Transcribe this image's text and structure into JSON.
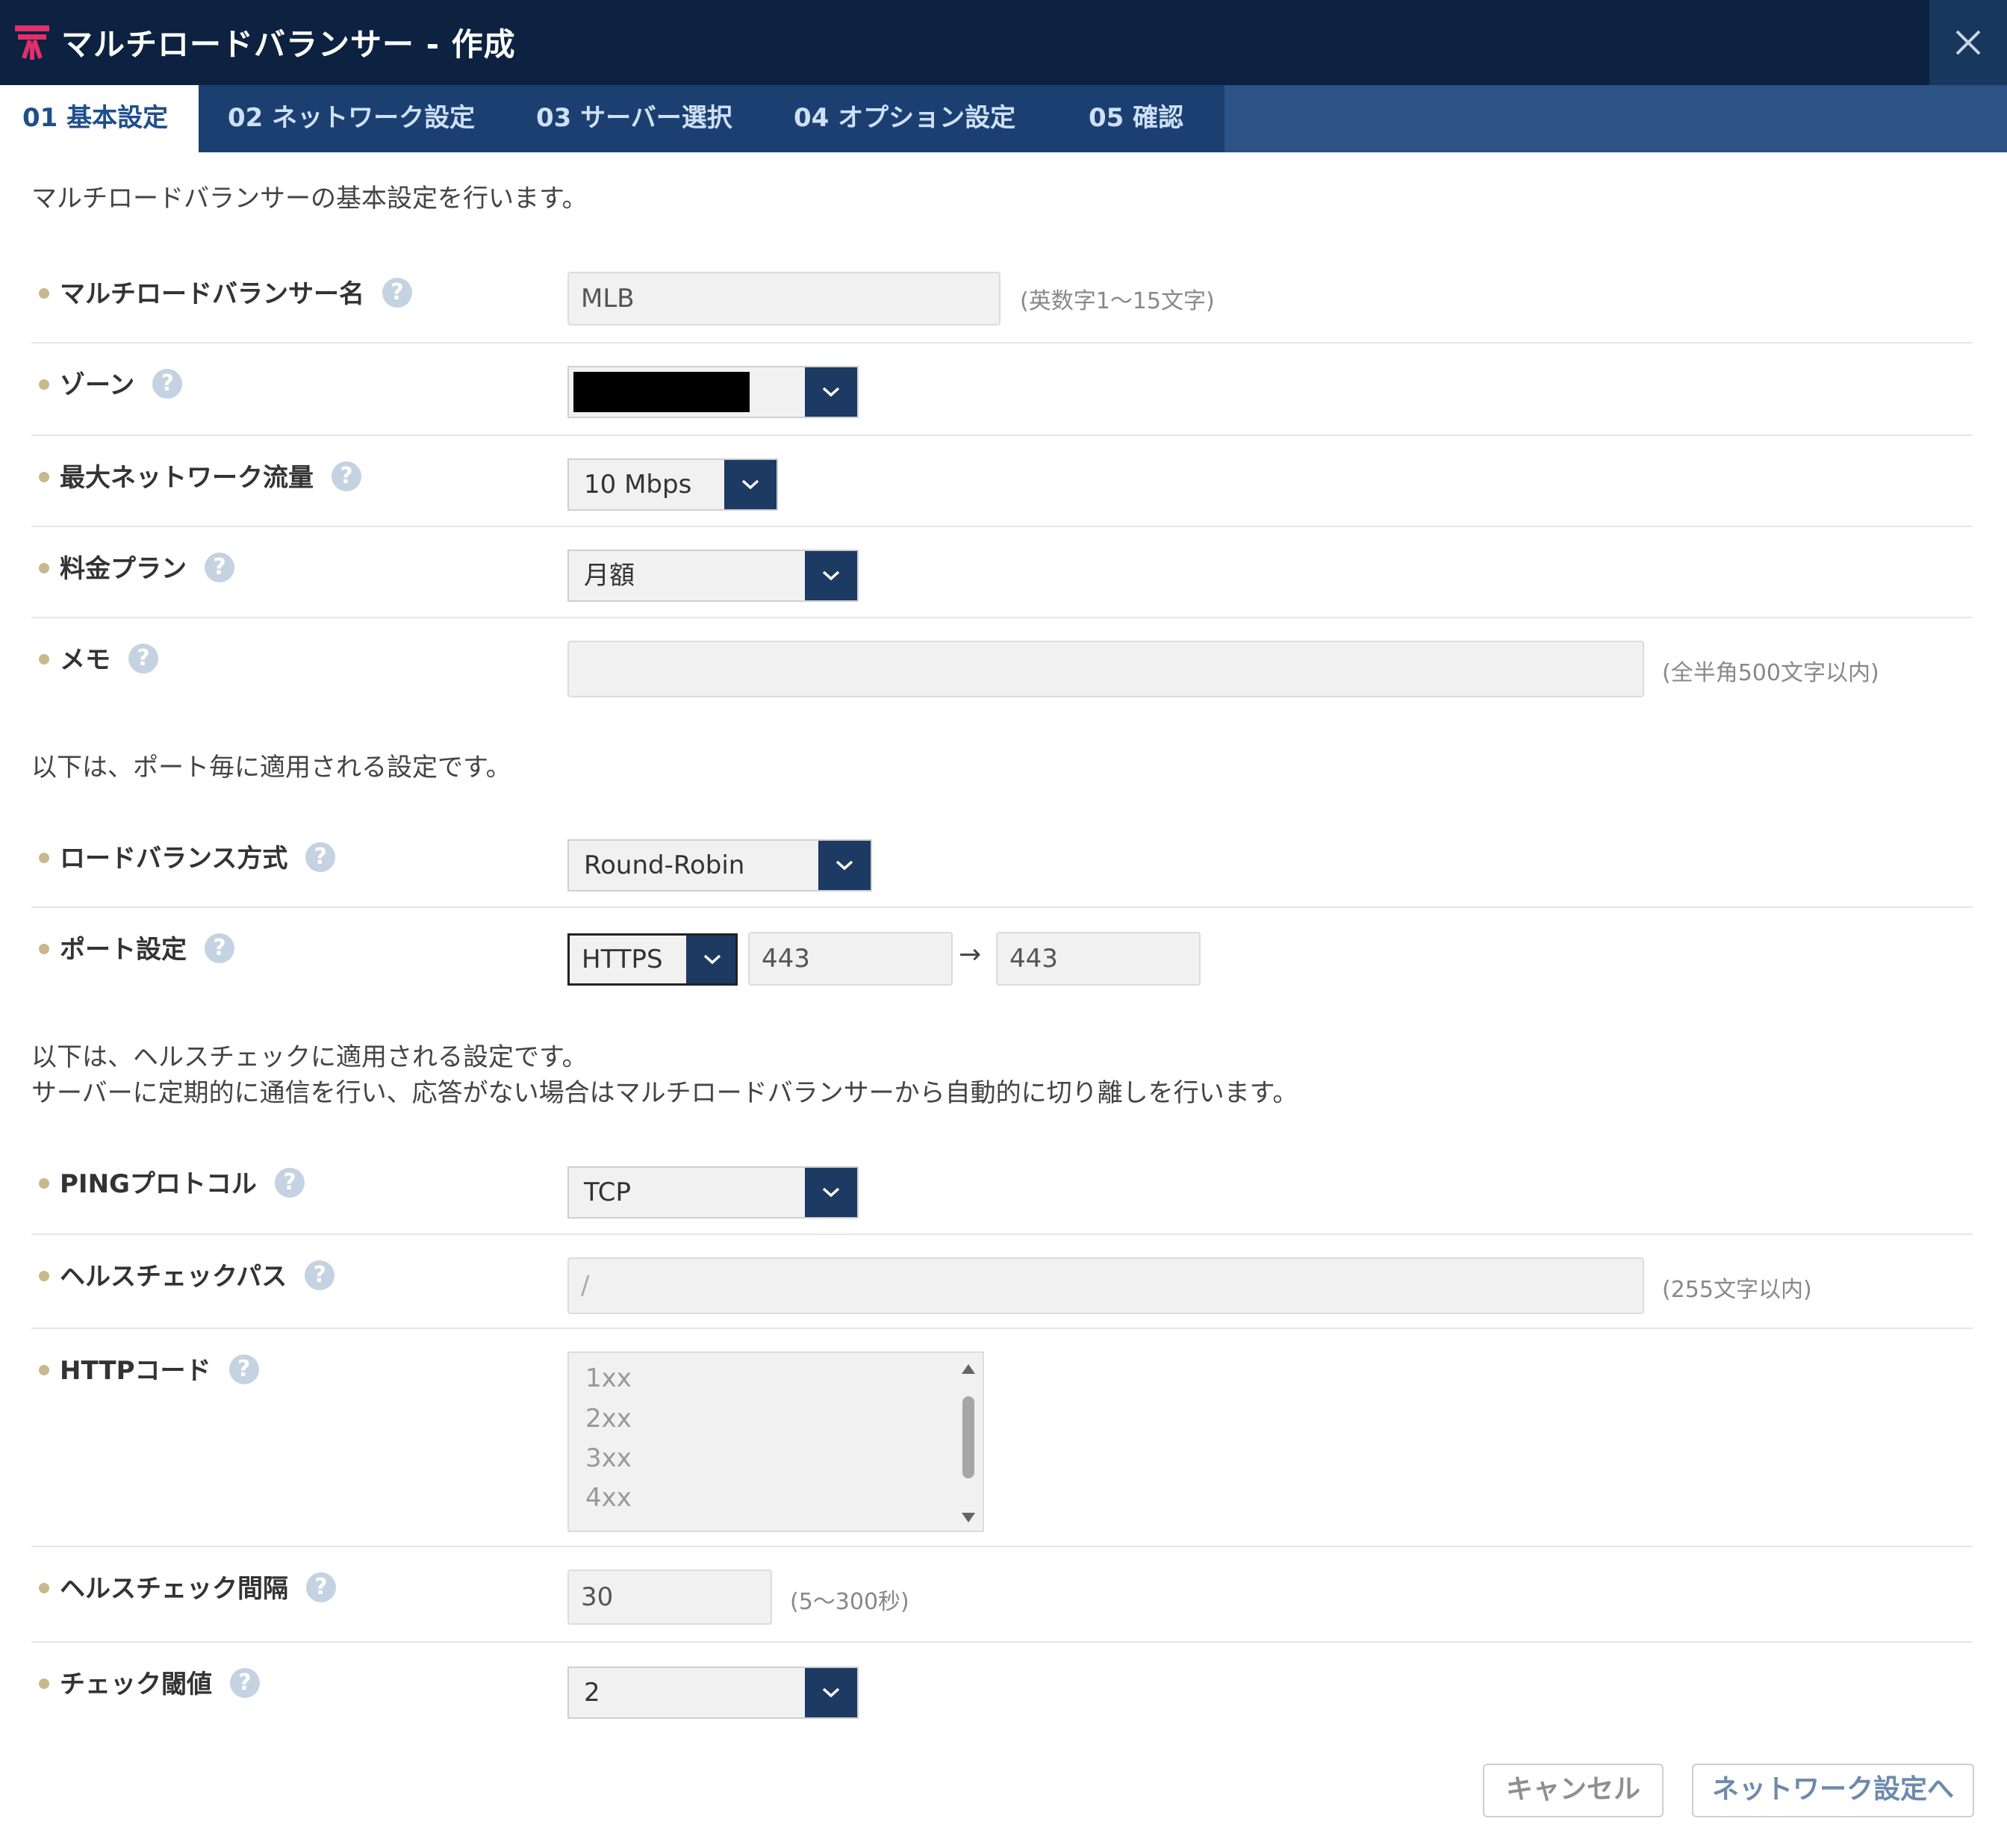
{
  "window": {
    "title": "マルチロードバランサー - 作成",
    "logo_icon": "sakura-cloud-logo-icon",
    "close_icon": "close-icon"
  },
  "tabs": [
    {
      "label": "01 基本設定",
      "active": true
    },
    {
      "label": "02 ネットワーク設定",
      "active": false
    },
    {
      "label": "03 サーバー選択",
      "active": false
    },
    {
      "label": "04 オプション設定",
      "active": false
    },
    {
      "label": "05 確認",
      "active": false
    }
  ],
  "intro": {
    "basic": "マルチロードバランサーの基本設定を行います。",
    "port": "以下は、ポート毎に適用される設定です。",
    "health_line1": "以下は、ヘルスチェックに適用される設定です。",
    "health_line2": "サーバーに定期的に通信を行い、応答がない場合はマルチロードバランサーから自動的に切り離しを行います。"
  },
  "help_glyph": "?",
  "fields": {
    "name": {
      "label": "マルチロードバランサー名",
      "value": "MLB",
      "hint": "(英数字1～15文字)"
    },
    "zone": {
      "label": "ゾーン",
      "value": ""
    },
    "bandwidth": {
      "label": "最大ネットワーク流量",
      "value": "10 Mbps"
    },
    "plan": {
      "label": "料金プラン",
      "value": "月額"
    },
    "memo": {
      "label": "メモ",
      "value": "",
      "hint": "(全半角500文字以内)"
    },
    "balance": {
      "label": "ロードバランス方式",
      "value": "Round-Robin"
    },
    "port": {
      "label": "ポート設定",
      "protocol": "HTTPS",
      "from": "443",
      "arrow": "→",
      "to": "443"
    },
    "ping": {
      "label": "PINGプロトコル",
      "value": "TCP"
    },
    "path": {
      "label": "ヘルスチェックパス",
      "placeholder": "/",
      "hint": "(255文字以内)"
    },
    "http_code": {
      "label": "HTTPコード",
      "options": [
        "1xx",
        "2xx",
        "3xx",
        "4xx"
      ]
    },
    "interval": {
      "label": "ヘルスチェック間隔",
      "value": "30",
      "hint": "(5～300秒)"
    },
    "threshold": {
      "label": "チェック閾値",
      "value": "2"
    }
  },
  "buttons": {
    "cancel": "キャンセル",
    "next": "ネットワーク設定へ"
  },
  "colors": {
    "titlebar": "#0c2240",
    "tabbar": "#2c5286",
    "select_button": "#1d3a63",
    "label_dot": "#c7b98d",
    "button_text": "#6d89ad"
  }
}
